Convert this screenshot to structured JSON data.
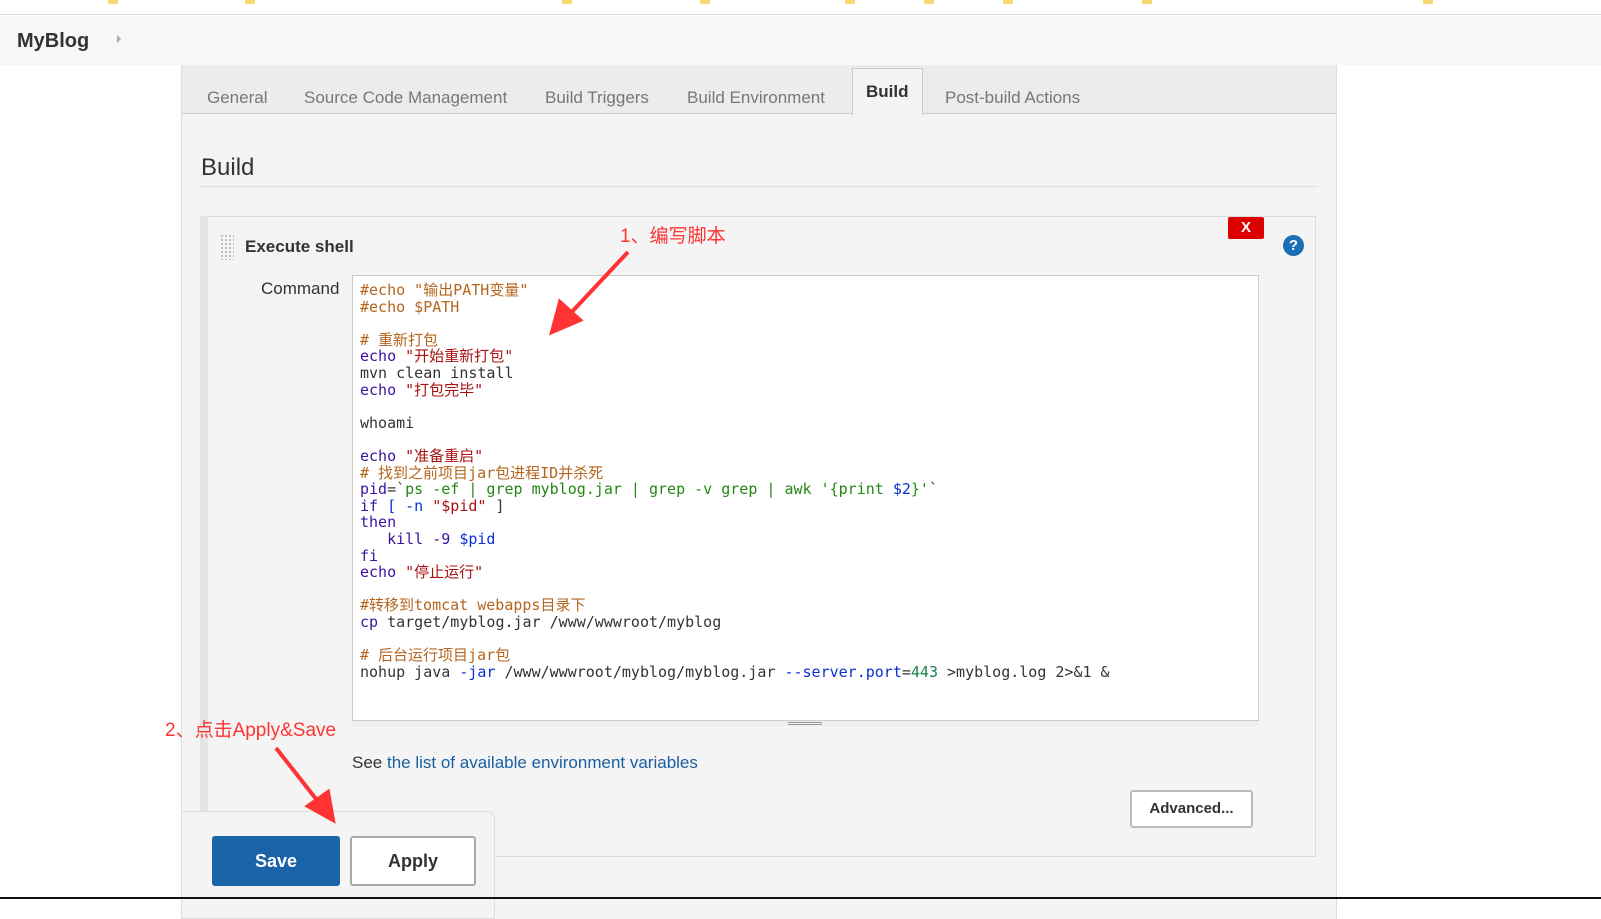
{
  "breadcrumb": {
    "job": "MyBlog"
  },
  "tabs": [
    "General",
    "Source Code Management",
    "Build Triggers",
    "Build Environment",
    "Build",
    "Post-build Actions"
  ],
  "active_tab": "Build",
  "section": {
    "title": "Build"
  },
  "step": {
    "title": "Execute shell",
    "delete_label": "X",
    "help_label": "?",
    "command_label": "Command",
    "code": [
      [
        [
          "#echo \"输出PATH变量\"",
          "c"
        ]
      ],
      [
        [
          "#echo $PATH",
          "c"
        ]
      ],
      [],
      [
        [
          "# 重新打包",
          "c"
        ]
      ],
      [
        [
          "echo ",
          "k"
        ],
        [
          "\"开始重新打包\"",
          "s"
        ]
      ],
      [
        [
          "mvn clean install",
          "p"
        ]
      ],
      [
        [
          "echo ",
          "k"
        ],
        [
          "\"打包完毕\"",
          "s"
        ]
      ],
      [],
      [
        [
          "whoami",
          "p"
        ]
      ],
      [],
      [
        [
          "echo ",
          "k"
        ],
        [
          "\"准备重启\"",
          "s"
        ]
      ],
      [
        [
          "# 找到之前项目jar包进程ID并杀死",
          "c"
        ]
      ],
      [
        [
          "pid",
          "k"
        ],
        [
          "=`",
          "p"
        ],
        [
          "ps -ef | grep myblog.jar | grep -v grep | awk '{print ",
          "g"
        ],
        [
          "$2",
          "v"
        ],
        [
          "}'",
          "g"
        ],
        [
          "`",
          "p"
        ]
      ],
      [
        [
          "if",
          "k"
        ],
        [
          " [ -n ",
          "v"
        ],
        [
          "\"$pid\"",
          "s"
        ],
        [
          " ]",
          "p"
        ]
      ],
      [
        [
          "then",
          "k"
        ]
      ],
      [
        [
          "   kill -9 ",
          "k"
        ],
        [
          "$pid",
          "v"
        ]
      ],
      [
        [
          "fi",
          "k"
        ]
      ],
      [
        [
          "echo ",
          "k"
        ],
        [
          "\"停止运行\"",
          "s"
        ]
      ],
      [],
      [
        [
          "#转移到tomcat webapps目录下",
          "c"
        ]
      ],
      [
        [
          "cp ",
          "k"
        ],
        [
          "target/myblog.jar /www/wwwroot/myblog",
          "p"
        ]
      ],
      [],
      [
        [
          "# 后台运行项目jar包",
          "c"
        ]
      ],
      [
        [
          "nohup java ",
          "p"
        ],
        [
          "-jar",
          "v"
        ],
        [
          " /www/wwwroot/myblog/myblog.jar ",
          "p"
        ],
        [
          "--server.port",
          "v"
        ],
        [
          "=",
          "p"
        ],
        [
          "443",
          "n"
        ],
        [
          " >myblog.log 2>&1 &",
          "p"
        ]
      ]
    ],
    "help_prefix": "See ",
    "help_link": "the list of available environment variables",
    "advanced_label": "Advanced..."
  },
  "buttons": {
    "save": "Save",
    "apply": "Apply"
  },
  "annotations": {
    "step1": "1、编写脚本",
    "step2": "2、点击Apply&Save",
    "color": "#ff3333"
  }
}
